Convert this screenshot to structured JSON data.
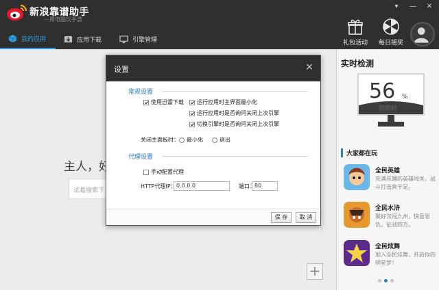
{
  "app": {
    "title": "新浪靠谱助手",
    "subtitle": "—用电脑玩手游"
  },
  "window_controls": [
    "▾",
    "—",
    "✕"
  ],
  "nav_tabs": [
    {
      "label": "我的应用",
      "icon": "cube-icon",
      "active": true
    },
    {
      "label": "应用下载",
      "icon": "download-box-icon",
      "active": false
    },
    {
      "label": "引擎管理",
      "icon": "monitor-icon",
      "active": false
    }
  ],
  "top_actions": [
    {
      "label": "礼包活动",
      "icon": "gift-icon"
    },
    {
      "label": "每日摇奖",
      "icon": "lottery-wheel-icon"
    }
  ],
  "main": {
    "greeting": "主人，好",
    "search_placeholder": "试着搜索下",
    "add_label": "+"
  },
  "right_panel": {
    "title": "实时检测",
    "score": "56",
    "unit": "%",
    "status": "刚刚好",
    "playing_title": "大家都在玩",
    "games": [
      {
        "name": "全民英雄",
        "desc": "充满乐趣的英雄闯关，战斗打击爽干足。"
      },
      {
        "name": "全民水浒",
        "desc": "聚好汉闯九州，快意恩仇，征战四方。"
      },
      {
        "name": "全民炫舞",
        "desc": "加入全民炫舞，开启你的明星梦！"
      }
    ],
    "page_dots": 3,
    "active_dot": 1
  },
  "dialog": {
    "title": "设置",
    "close": "×",
    "general_section": "常规设置",
    "options": [
      {
        "label": "使用迅雷下载",
        "checked": true
      },
      {
        "label": "运行应用时主界面最小化",
        "checked": true
      },
      {
        "label": "运行应用时是否询问关闭上次引擎",
        "checked": true
      },
      {
        "label": "切换引擎时是否询问关闭上次引擎",
        "checked": true
      }
    ],
    "close_main_label": "关闭主面板时：",
    "radio_minimize": "最小化",
    "radio_exit": "退出",
    "proxy_section": "代理设置",
    "manual_proxy_label": "手动配置代理",
    "manual_proxy_checked": false,
    "http_proxy_label": "HTTP代理IP：",
    "http_proxy_value": "0.0.0.0",
    "port_label": "端口：",
    "port_value": "80",
    "save_label": "保 存",
    "cancel_label": "取 消"
  }
}
